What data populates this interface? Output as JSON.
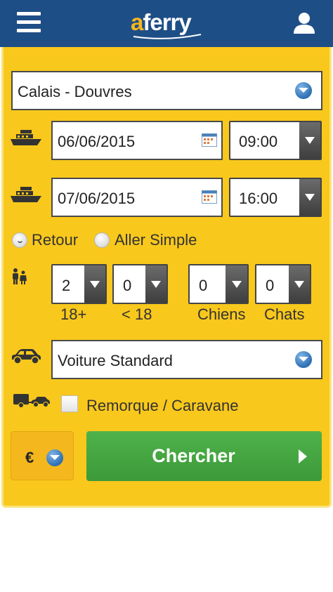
{
  "header": {
    "logo_prefix": "a",
    "logo_rest": "ferry"
  },
  "route": {
    "value": "Calais - Douvres"
  },
  "outbound": {
    "date": "06/06/2015",
    "time": "09:00"
  },
  "return": {
    "date": "07/06/2015",
    "time": "16:00"
  },
  "trip_type": {
    "options": [
      "Retour",
      "Aller Simple"
    ],
    "selected": "Retour"
  },
  "passengers": [
    {
      "value": "2",
      "label": "18+"
    },
    {
      "value": "0",
      "label": "< 18"
    },
    {
      "value": "0",
      "label": "Chiens"
    },
    {
      "value": "0",
      "label": "Chats"
    }
  ],
  "vehicle": {
    "value": "Voiture Standard"
  },
  "trailer": {
    "label": "Remorque / Caravane",
    "checked": false
  },
  "currency": {
    "symbol": "€"
  },
  "search": {
    "label": "Chercher"
  },
  "colors": {
    "header_bg": "#1e4e86",
    "panel_bg": "#f8c81c",
    "search_green": "#43a43f",
    "logo_accent": "#f7b61e"
  }
}
